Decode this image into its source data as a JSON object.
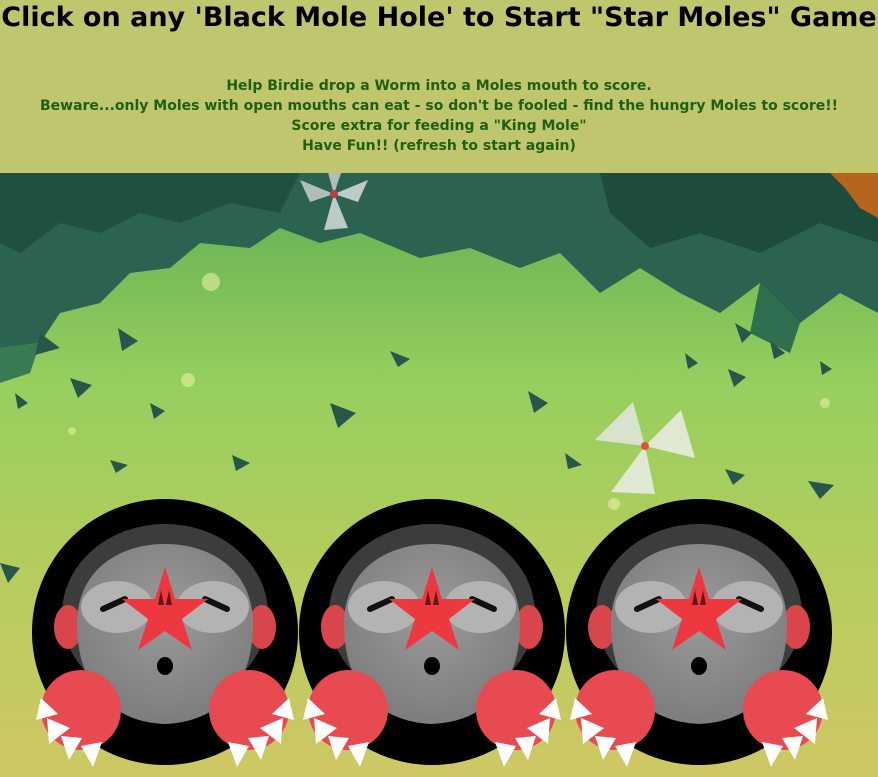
{
  "header": {
    "title": "Click on any 'Black Mole Hole' to Start \"Star Moles\" Game",
    "instructions": [
      "Help Birdie drop a Worm into a Moles mouth to score.",
      "Beware...only Moles with open mouths can eat - so don't be fooled - find the hungry Moles to score!!",
      "Score extra for feeding a \"King Mole\"",
      "Have Fun!! (refresh to start again)"
    ]
  },
  "game": {
    "mole_holes": [
      {
        "id": 1,
        "mole": "star-mole",
        "mouth": "closed"
      },
      {
        "id": 2,
        "mole": "star-mole",
        "mouth": "closed"
      },
      {
        "id": 3,
        "mole": "star-mole",
        "mouth": "closed"
      }
    ]
  },
  "colors": {
    "header_bg": "#c0c66e",
    "instruction_text": "#1f5f12",
    "dark_canopy": "#24584a",
    "grass": "#8fcb5e",
    "mole_grey": "#8c8c8c",
    "star_red": "#ee3840",
    "claw_white": "#ffffff"
  },
  "icons": [
    "pinwheel-icon",
    "star-icon",
    "mole-claw-icon"
  ]
}
